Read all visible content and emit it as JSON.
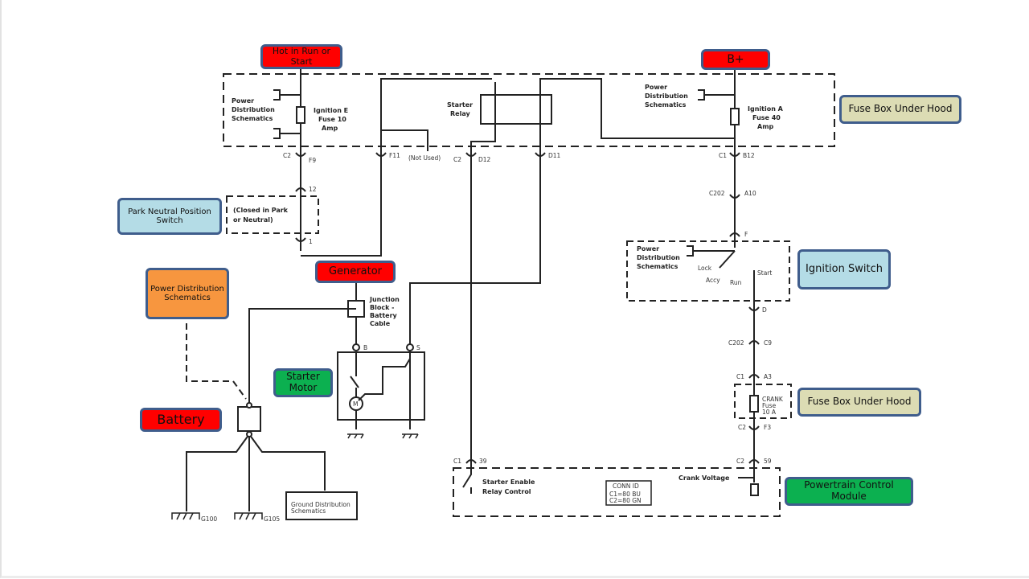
{
  "callouts": {
    "hot_in_run": "Hot in Run or Start",
    "b_plus": "B+",
    "fuse_box_top": "Fuse Box Under Hood",
    "park_neutral": "Park Neutral Position Switch",
    "generator": "Generator",
    "power_dist": "Power Distribution Schematics",
    "starter_motor": "Starter Motor",
    "battery": "Battery",
    "ignition_switch": "Ignition Switch",
    "fuse_box_crank": "Fuse Box Under Hood",
    "pcm": "Powertrain Control Module"
  },
  "labels": {
    "pds1_l1": "Power",
    "pds1_l2": "Distribution",
    "pds1_l3": "Schematics",
    "ign_e_l1": "Ignition E",
    "ign_e_l2": "Fuse 10",
    "ign_e_l3": "Amp",
    "starter_relay_l1": "Starter",
    "starter_relay_l2": "Relay",
    "pds2_l1": "Power",
    "pds2_l2": "Distribution",
    "pds2_l3": "Schematics",
    "ign_a_l1": "Ignition A",
    "ign_a_l2": "Fuse 40",
    "ign_a_l3": "Amp",
    "c2": "C2",
    "f9": "F9",
    "f11": "F11",
    "not_used": "(Not Used)",
    "c2b": "C2",
    "d12": "D12",
    "d11": "D11",
    "c1": "C1",
    "b12": "B12",
    "pin12": "12",
    "pin1": "1",
    "pns_l1": "(Closed in Park",
    "pns_l2": "or Neutral)",
    "c202a": "C202",
    "a10": "A10",
    "f": "F",
    "pds3_l1": "Power",
    "pds3_l2": "Distribution",
    "pds3_l3": "Schematics",
    "lock": "Lock",
    "accy": "Accy",
    "run": "Run",
    "start": "Start",
    "d": "D",
    "c202b": "C202",
    "c9": "C9",
    "c1b": "C1",
    "a3": "A3",
    "crank_l1": "CRANK",
    "crank_l2": "Fuse",
    "crank_l3": "10 A",
    "c2c": "C2",
    "f3": "F3",
    "jb_l1": "Junction",
    "jb_l2": "Block -",
    "jb_l3": "Battery",
    "jb_l4": "Cable",
    "term_b": "B",
    "term_s": "S",
    "motor_m": "M",
    "c1c": "C1",
    "pin39": "39",
    "c2d": "C2",
    "pin59": "59",
    "ser_l1": "Starter Enable",
    "ser_l2": "Relay Control",
    "crank_voltage": "Crank Voltage",
    "conn_id": "CONN ID",
    "conn_c1": "C1=80 BU",
    "conn_c2": "C2=80 GN",
    "gnd_l1": "Ground Distribution",
    "gnd_l2": "Schematics",
    "g100": "G100",
    "g105": "G105"
  }
}
